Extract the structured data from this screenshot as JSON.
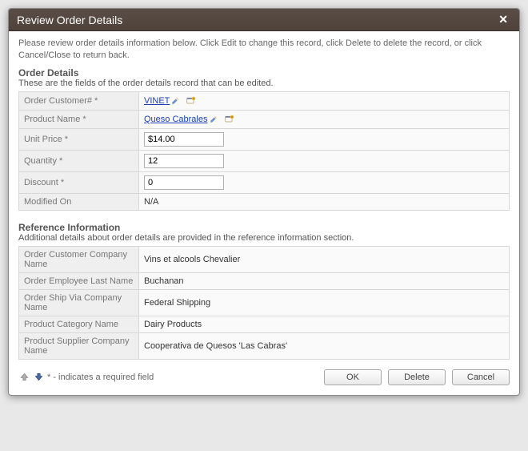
{
  "dialog": {
    "title": "Review Order Details",
    "instructions": "Please review order details information below. Click Edit to change this record, click Delete to delete the record, or click Cancel/Close to return back."
  },
  "sections": {
    "details": {
      "title": "Order Details",
      "desc": "These are the fields of the order details record that can be edited.",
      "fields": {
        "order_customer": {
          "label": "Order Customer#",
          "required": true,
          "value": "VINET"
        },
        "product_name": {
          "label": "Product Name",
          "required": true,
          "value": "Queso Cabrales"
        },
        "unit_price": {
          "label": "Unit Price",
          "required": true,
          "value": "$14.00"
        },
        "quantity": {
          "label": "Quantity",
          "required": true,
          "value": "12"
        },
        "discount": {
          "label": "Discount",
          "required": true,
          "value": "0"
        },
        "modified_on": {
          "label": "Modified On",
          "required": false,
          "value": "N/A"
        }
      }
    },
    "reference": {
      "title": "Reference Information",
      "desc": "Additional details about order details are provided in the reference information section.",
      "fields": {
        "cust_company": {
          "label": "Order Customer Company Name",
          "value": "Vins et alcools Chevalier"
        },
        "emp_last": {
          "label": "Order Employee Last Name",
          "value": "Buchanan"
        },
        "ship_via": {
          "label": "Order Ship Via Company Name",
          "value": "Federal Shipping"
        },
        "prod_cat": {
          "label": "Product Category Name",
          "value": "Dairy Products"
        },
        "prod_supplier": {
          "label": "Product Supplier Company Name",
          "value": "Cooperativa de Quesos 'Las Cabras'"
        }
      }
    }
  },
  "footer": {
    "required_hint": "* - indicates a required field",
    "buttons": {
      "ok": "OK",
      "delete": "Delete",
      "cancel": "Cancel"
    }
  },
  "asterisk": "*"
}
